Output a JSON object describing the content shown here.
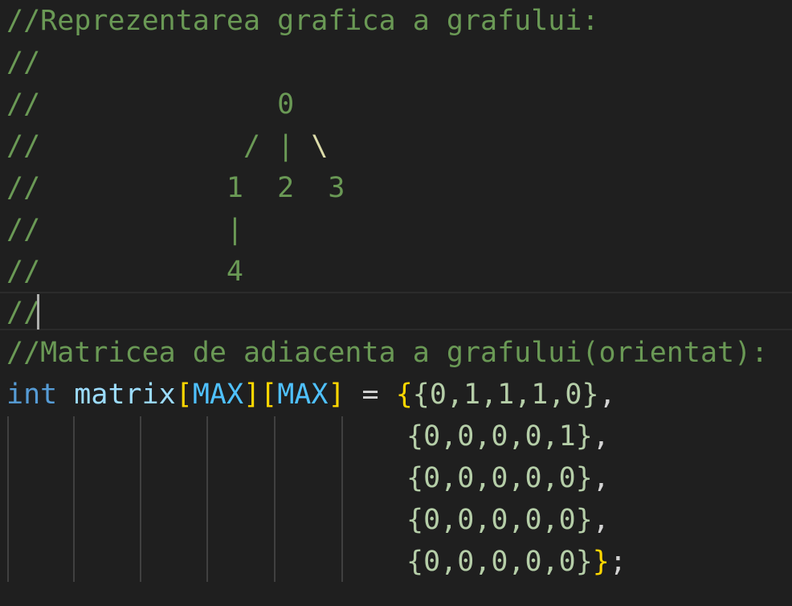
{
  "editor": {
    "comment_lines": [
      "//Reprezentarea grafica a grafului:",
      "//",
      "//              0",
      "//            / |",
      "//           1  2  3",
      "//           |",
      "//           4",
      "//",
      "//Matricea de adiacenta a grafului(orientat):"
    ],
    "backslash": "\\",
    "declaration": {
      "type": "int",
      "name": "matrix",
      "open1": "[",
      "dim1": "MAX",
      "close1": "]",
      "open2": "[",
      "dim2": "MAX",
      "close2": "]",
      "assign": " = ",
      "outer_open": "{",
      "rows": [
        "{0,1,1,1,0}",
        "{0,0,0,0,1}",
        "{0,0,0,0,0}",
        "{0,0,0,0,0}",
        "{0,0,0,0,0}"
      ],
      "row_sep": ",",
      "outer_close": "}",
      "terminator": ";"
    },
    "colors": {
      "background": "#1f1f1f",
      "comment": "#6a9955",
      "keyword": "#569cd6",
      "variable": "#9cdcfe",
      "constant": "#4fc1ff",
      "number": "#b5cea8"
    }
  }
}
